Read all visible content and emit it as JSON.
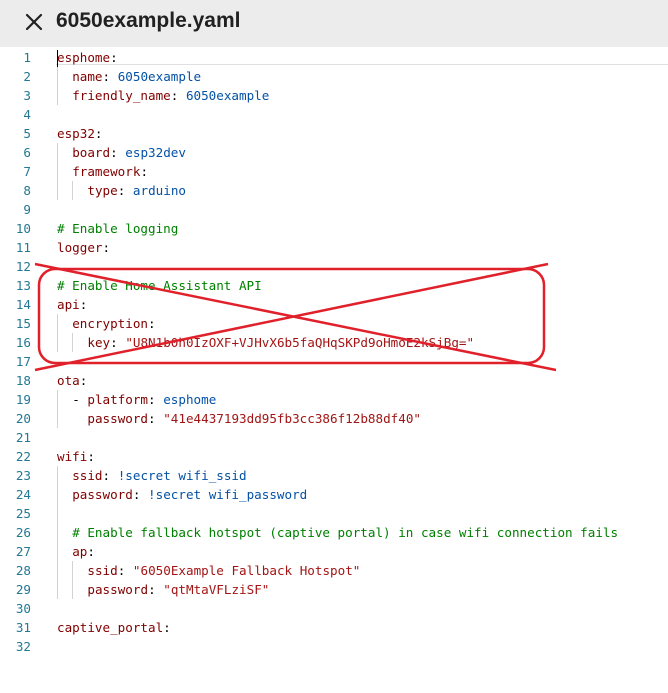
{
  "header": {
    "title": "6050example.yaml",
    "close_icon": "close-icon"
  },
  "colors": {
    "line_number": "#237893",
    "key": "#800000",
    "value": "#0451a5",
    "string": "#a31515",
    "comment": "#008000",
    "annotation": "#e0202a"
  },
  "editor": {
    "lines": [
      {
        "num": "1",
        "indent": 0,
        "parts": [
          {
            "t": "esphome",
            "c": "k"
          },
          {
            "t": ":",
            "c": "p"
          }
        ]
      },
      {
        "num": "2",
        "indent": 1,
        "parts": [
          {
            "t": "name",
            "c": "k"
          },
          {
            "t": ": ",
            "c": "p"
          },
          {
            "t": "6050example",
            "c": "s"
          }
        ]
      },
      {
        "num": "3",
        "indent": 1,
        "parts": [
          {
            "t": "friendly_name",
            "c": "k"
          },
          {
            "t": ": ",
            "c": "p"
          },
          {
            "t": "6050example",
            "c": "s"
          }
        ]
      },
      {
        "num": "4",
        "indent": 0,
        "parts": []
      },
      {
        "num": "5",
        "indent": 0,
        "parts": [
          {
            "t": "esp32",
            "c": "k"
          },
          {
            "t": ":",
            "c": "p"
          }
        ]
      },
      {
        "num": "6",
        "indent": 1,
        "parts": [
          {
            "t": "board",
            "c": "k"
          },
          {
            "t": ": ",
            "c": "p"
          },
          {
            "t": "esp32dev",
            "c": "s"
          }
        ]
      },
      {
        "num": "7",
        "indent": 1,
        "parts": [
          {
            "t": "framework",
            "c": "k"
          },
          {
            "t": ":",
            "c": "p"
          }
        ]
      },
      {
        "num": "8",
        "indent": 2,
        "parts": [
          {
            "t": "type",
            "c": "k"
          },
          {
            "t": ": ",
            "c": "p"
          },
          {
            "t": "arduino",
            "c": "s"
          }
        ]
      },
      {
        "num": "9",
        "indent": 0,
        "parts": []
      },
      {
        "num": "10",
        "indent": 0,
        "parts": [
          {
            "t": "# Enable logging",
            "c": "c"
          }
        ]
      },
      {
        "num": "11",
        "indent": 0,
        "parts": [
          {
            "t": "logger",
            "c": "k"
          },
          {
            "t": ":",
            "c": "p"
          }
        ]
      },
      {
        "num": "12",
        "indent": 0,
        "parts": []
      },
      {
        "num": "13",
        "indent": 0,
        "parts": [
          {
            "t": "# Enable Home Assistant API",
            "c": "c"
          }
        ]
      },
      {
        "num": "14",
        "indent": 0,
        "parts": [
          {
            "t": "api",
            "c": "k"
          },
          {
            "t": ":",
            "c": "p"
          }
        ]
      },
      {
        "num": "15",
        "indent": 1,
        "parts": [
          {
            "t": "encryption",
            "c": "k"
          },
          {
            "t": ":",
            "c": "p"
          }
        ]
      },
      {
        "num": "16",
        "indent": 2,
        "parts": [
          {
            "t": "key",
            "c": "k"
          },
          {
            "t": ": ",
            "c": "p"
          },
          {
            "t": "\"U8N1b0h0IzOXF+VJHvX6b5faQHqSKPd9oHmoE2kSjBg=\"",
            "c": "str"
          }
        ]
      },
      {
        "num": "17",
        "indent": 0,
        "parts": []
      },
      {
        "num": "18",
        "indent": 0,
        "parts": [
          {
            "t": "ota",
            "c": "k"
          },
          {
            "t": ":",
            "c": "p"
          }
        ]
      },
      {
        "num": "19",
        "indent": 1,
        "parts": [
          {
            "t": "- ",
            "c": "p"
          },
          {
            "t": "platform",
            "c": "k"
          },
          {
            "t": ": ",
            "c": "p"
          },
          {
            "t": "esphome",
            "c": "s"
          }
        ]
      },
      {
        "num": "20",
        "indent": 1,
        "parts": [
          {
            "t": "  ",
            "c": "p"
          },
          {
            "t": "password",
            "c": "k"
          },
          {
            "t": ": ",
            "c": "p"
          },
          {
            "t": "\"41e4437193dd95fb3cc386f12b88df40\"",
            "c": "str"
          }
        ]
      },
      {
        "num": "21",
        "indent": 0,
        "parts": []
      },
      {
        "num": "22",
        "indent": 0,
        "parts": [
          {
            "t": "wifi",
            "c": "k"
          },
          {
            "t": ":",
            "c": "p"
          }
        ]
      },
      {
        "num": "23",
        "indent": 1,
        "parts": [
          {
            "t": "ssid",
            "c": "k"
          },
          {
            "t": ": ",
            "c": "p"
          },
          {
            "t": "!secret wifi_ssid",
            "c": "s"
          }
        ]
      },
      {
        "num": "24",
        "indent": 1,
        "parts": [
          {
            "t": "password",
            "c": "k"
          },
          {
            "t": ": ",
            "c": "p"
          },
          {
            "t": "!secret wifi_password",
            "c": "s"
          }
        ]
      },
      {
        "num": "25",
        "indent": 1,
        "parts": []
      },
      {
        "num": "26",
        "indent": 1,
        "parts": [
          {
            "t": "# Enable fallback hotspot (captive portal) in case wifi connection fails",
            "c": "c"
          }
        ]
      },
      {
        "num": "27",
        "indent": 1,
        "parts": [
          {
            "t": "ap",
            "c": "k"
          },
          {
            "t": ":",
            "c": "p"
          }
        ]
      },
      {
        "num": "28",
        "indent": 2,
        "parts": [
          {
            "t": "ssid",
            "c": "k"
          },
          {
            "t": ": ",
            "c": "p"
          },
          {
            "t": "\"6050Example Fallback Hotspot\"",
            "c": "str"
          }
        ]
      },
      {
        "num": "29",
        "indent": 2,
        "parts": [
          {
            "t": "password",
            "c": "k"
          },
          {
            "t": ": ",
            "c": "p"
          },
          {
            "t": "\"qtMtaVFLziSF\"",
            "c": "str"
          }
        ]
      },
      {
        "num": "30",
        "indent": 0,
        "parts": []
      },
      {
        "num": "31",
        "indent": 0,
        "parts": [
          {
            "t": "captive_portal",
            "c": "k"
          },
          {
            "t": ":",
            "c": "p"
          }
        ]
      },
      {
        "num": "32",
        "indent": 0,
        "parts": []
      }
    ]
  }
}
